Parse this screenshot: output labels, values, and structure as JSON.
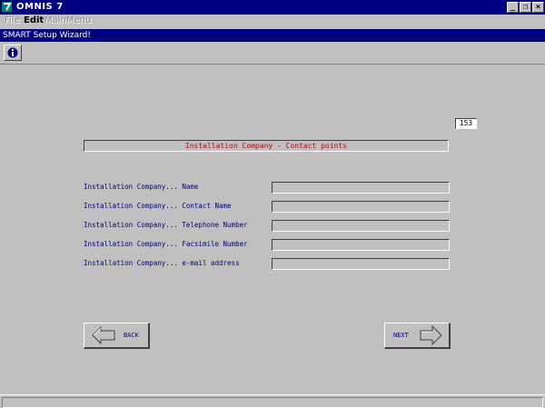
{
  "app": {
    "title": "OMNIS 7"
  },
  "window_controls": {
    "minimize": "_",
    "maximize": "❐",
    "close": "×"
  },
  "menubar": {
    "items": [
      {
        "label": "File",
        "enabled": false
      },
      {
        "label": "Edit",
        "enabled": true
      },
      {
        "label": "MainMenu",
        "enabled": false
      }
    ]
  },
  "wizard": {
    "title": "SMART Setup Wizard!"
  },
  "toolbar": {
    "info_icon": "info-icon"
  },
  "page": {
    "number": "153",
    "heading": "Installation Company - Contact points"
  },
  "fields": [
    {
      "label": "Installation Company... Name",
      "value": ""
    },
    {
      "label": "Installation Company... Contact Name",
      "value": ""
    },
    {
      "label": "Installation Company... Telephone Number",
      "value": ""
    },
    {
      "label": "Installation Company... Facsimile Number",
      "value": ""
    },
    {
      "label": "Installation Company... e-mail address",
      "value": ""
    }
  ],
  "navigation": {
    "back_label": "BACK",
    "next_label": "NEXT"
  },
  "colors": {
    "titlebar": "#000080",
    "face": "#c0c0c0",
    "heading_text": "#c00000",
    "label_text": "#000080"
  }
}
